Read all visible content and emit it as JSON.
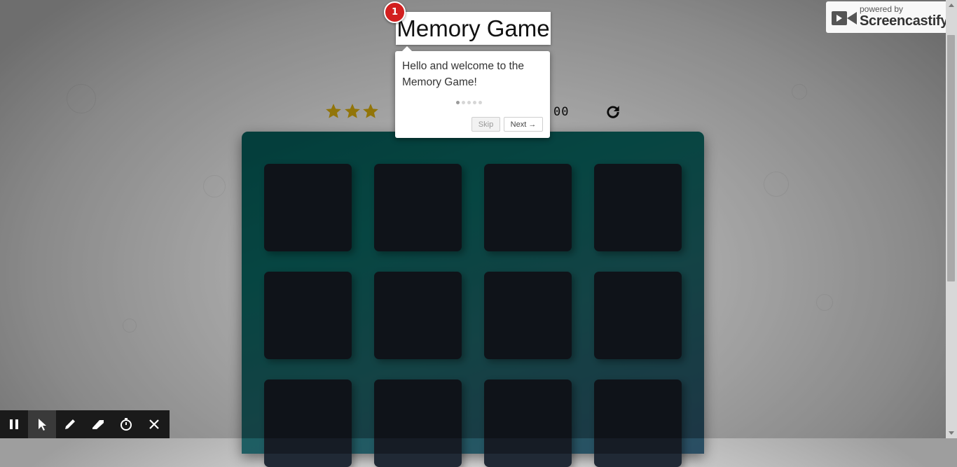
{
  "game": {
    "title": "Memory Game",
    "tour_step": "1",
    "stars": [
      {
        "icon": "star-icon",
        "filled": true
      },
      {
        "icon": "star-icon",
        "filled": true
      },
      {
        "icon": "star-icon",
        "filled": true
      }
    ],
    "timer_visible_fragment": "00",
    "restart_icon": "restart-icon",
    "cards": {
      "rows": 3,
      "cols": 4,
      "face": "hidden"
    },
    "colors": {
      "board_from": "#0a7f7a",
      "board_to": "#3e6f8e",
      "card": "#2e3b4c",
      "star": "#d1a80d",
      "badge": "#d21f1f"
    }
  },
  "tour": {
    "message": "Hello and welcome to the Memory Game!",
    "total_steps": 5,
    "current_step": 1,
    "skip_label": "Skip",
    "next_label": "Next →"
  },
  "watermark": {
    "small": "powered by",
    "big": "Screencastify"
  },
  "recorder_toolbar": {
    "tools": [
      {
        "icon": "pause-icon"
      },
      {
        "icon": "cursor-icon",
        "active": true
      },
      {
        "icon": "pen-icon"
      },
      {
        "icon": "eraser-icon"
      },
      {
        "icon": "timer-icon"
      },
      {
        "icon": "close-icon"
      }
    ]
  }
}
